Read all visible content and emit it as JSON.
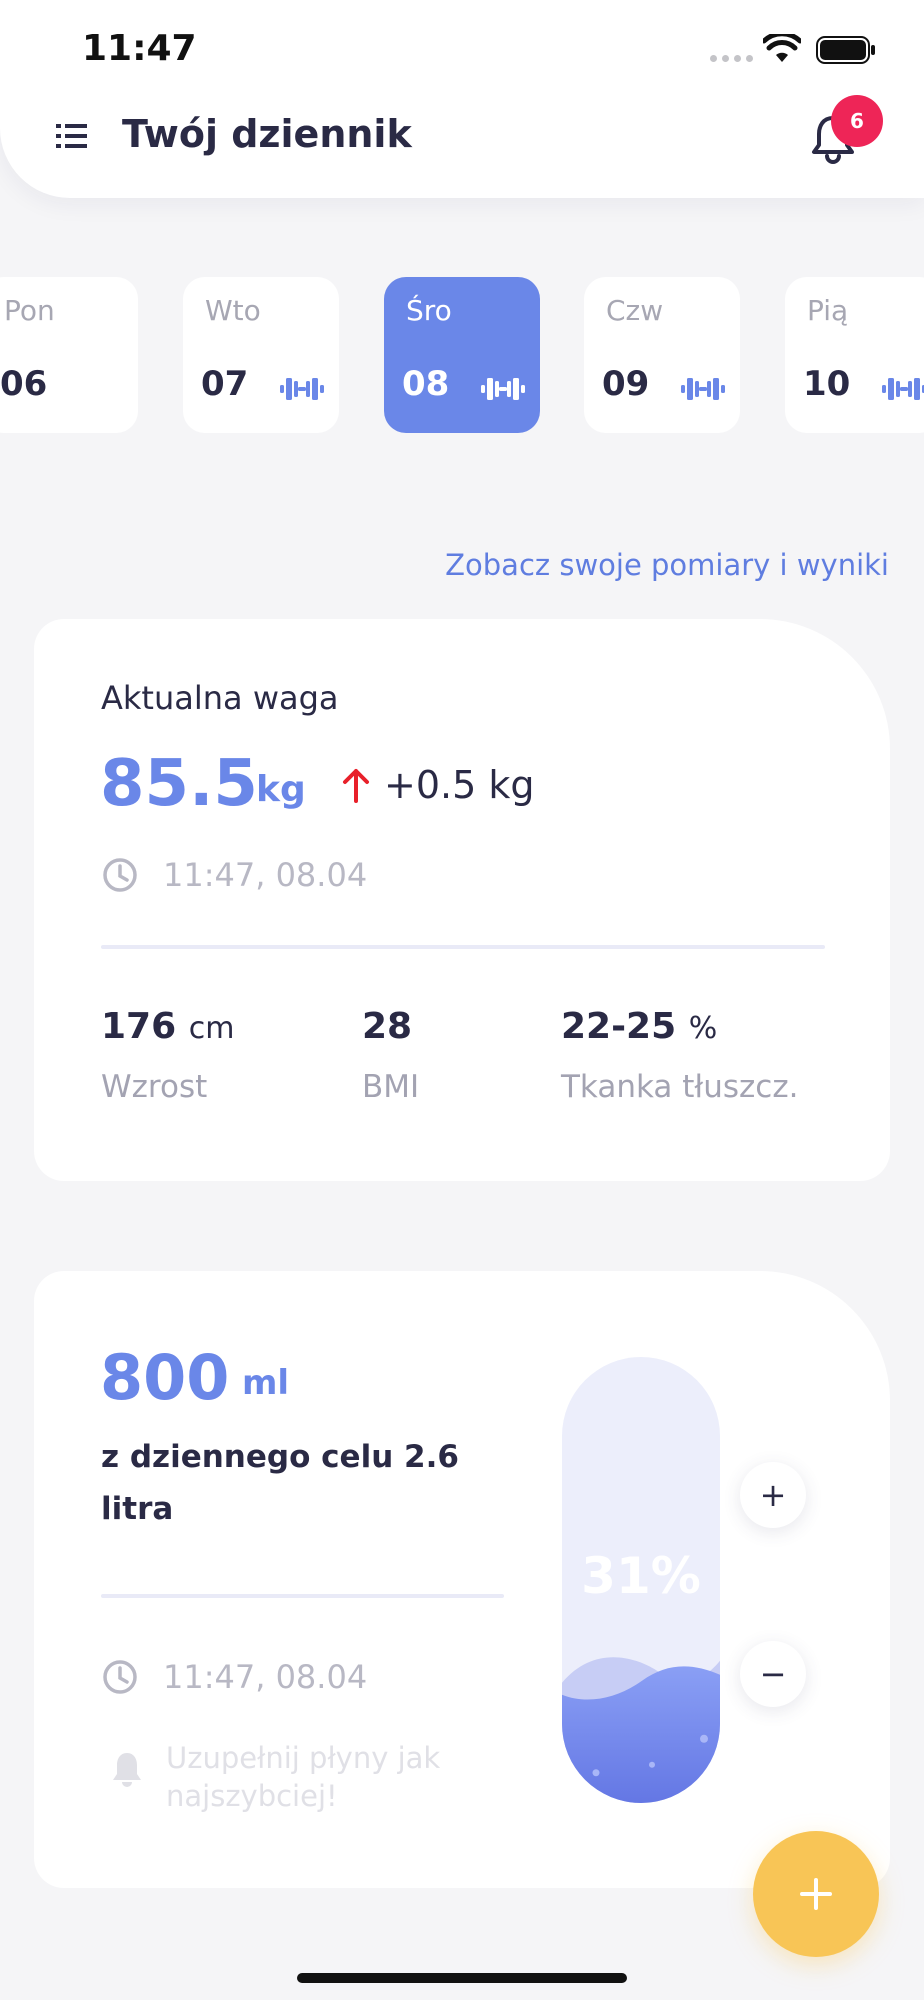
{
  "status_bar": {
    "time": "11:47"
  },
  "header": {
    "title": "Twój dziennik",
    "notification_count": "6"
  },
  "days": [
    {
      "name": "Pon",
      "number": "06",
      "workout": false,
      "active": false
    },
    {
      "name": "Wto",
      "number": "07",
      "workout": true,
      "active": false
    },
    {
      "name": "Śro",
      "number": "08",
      "workout": true,
      "active": true
    },
    {
      "name": "Czw",
      "number": "09",
      "workout": true,
      "active": false
    },
    {
      "name": "Pią",
      "number": "10",
      "workout": true,
      "active": false
    }
  ],
  "results_link": "Zobacz swoje pomiary i wyniki",
  "weight": {
    "label": "Aktualna waga",
    "value": "85.5",
    "unit": "kg",
    "change": "+0.5 kg",
    "timestamp": "11:47, 08.04",
    "stats": [
      {
        "value": "176",
        "unit": "cm",
        "label": "Wzrost"
      },
      {
        "value": "28",
        "unit": "",
        "label": "BMI"
      },
      {
        "value": "22-25",
        "unit": "%",
        "label": "Tkanka tłuszcz."
      }
    ]
  },
  "water": {
    "value": "800",
    "unit": "ml",
    "goal_text": "z dziennego celu 2.6 litra",
    "timestamp": "11:47, 08.04",
    "reminder": "Uzupełnij płyny jak najszybciej!",
    "percent_label": "31%",
    "fill_fraction": 0.31,
    "plus_label": "+",
    "minus_label": "−"
  },
  "colors": {
    "accent": "#6a87e8",
    "badge": "#ee2557",
    "fab": "#f8c556",
    "increase_arrow": "#e8202a"
  }
}
